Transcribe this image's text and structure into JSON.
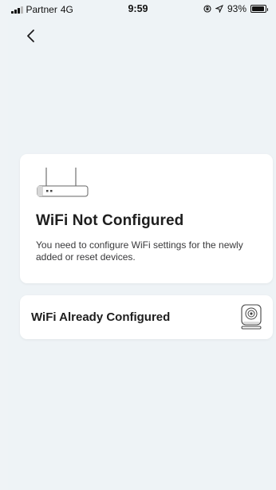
{
  "status_bar": {
    "carrier": "Partner",
    "network": "4G",
    "time": "9:59",
    "battery": "93%",
    "battery_level": 0.93
  },
  "nav": {
    "back_icon": "chevron-left-icon"
  },
  "options": [
    {
      "title": "WiFi Not Configured",
      "description": "You need to configure WiFi settings for the newly added or reset devices.",
      "icon": "router-icon"
    },
    {
      "title": "WiFi Already Configured",
      "icon": "camera-icon"
    }
  ],
  "colors": {
    "background": "#eff3f6",
    "card": "#ffffff",
    "text": "#1e1e1e"
  }
}
